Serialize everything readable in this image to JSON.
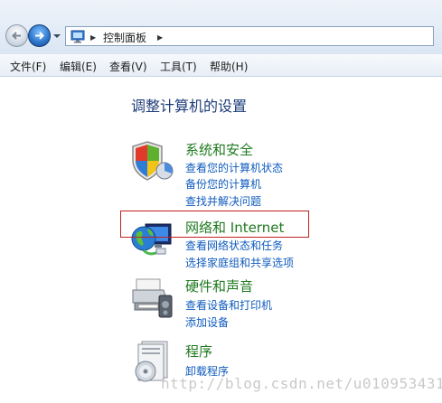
{
  "address_bar": {
    "crumbs": [
      "控制面板"
    ]
  },
  "menu": {
    "items": [
      "文件(F)",
      "编辑(E)",
      "查看(V)",
      "工具(T)",
      "帮助(H)"
    ]
  },
  "main": {
    "heading": "调整计算机的设置",
    "categories": [
      {
        "title": "系统和安全",
        "icon": "shield-icon",
        "links": [
          "查看您的计算机状态",
          "备份您的计算机",
          "查找并解决问题"
        ]
      },
      {
        "title": "网络和 Internet",
        "icon": "network-globe-icon",
        "links": [
          "查看网络状态和任务",
          "选择家庭组和共享选项"
        ]
      },
      {
        "title": "硬件和声音",
        "icon": "printer-icon",
        "links": [
          "查看设备和打印机",
          "添加设备"
        ]
      },
      {
        "title": "程序",
        "icon": "programs-icon",
        "links": [
          "卸载程序"
        ]
      }
    ]
  },
  "watermark": "http://blog.csdn.net/u010953431",
  "colors": {
    "category_title": "#1f7a1f",
    "link": "#0f5bbd",
    "heading": "#1d3d7a",
    "highlight": "#c32020"
  }
}
